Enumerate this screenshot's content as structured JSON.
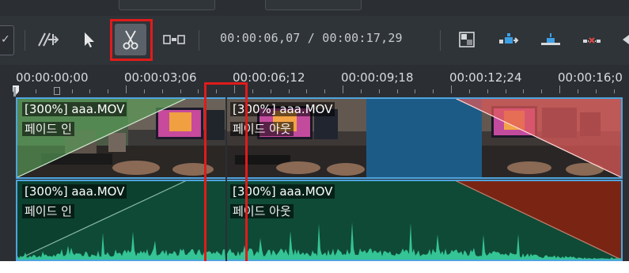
{
  "toolbar": {
    "tools": [
      {
        "name": "spacer-tool",
        "icon": "spacer-icon",
        "active": false
      },
      {
        "name": "select-tool",
        "icon": "cursor-icon",
        "active": false
      },
      {
        "name": "razor-tool",
        "icon": "scissors-icon",
        "active": true
      },
      {
        "name": "slip-tool",
        "icon": "slip-icon",
        "active": false
      }
    ],
    "position": "00:00:06,07",
    "separator": "/",
    "duration": "00:00:17,29",
    "right_tools": [
      "split-view-icon",
      "insert-icon",
      "overwrite-icon",
      "extract-icon",
      "lift-icon"
    ]
  },
  "ruler": {
    "labels": [
      "00:00:00;00",
      "00:00:03;06",
      "00:00:06;12",
      "00:00:09;18",
      "00:00:12;24",
      "00:00:16;0"
    ]
  },
  "tracks": {
    "video": [
      {
        "title": "[300%] aaa.MOV",
        "effect": "페이드 인"
      },
      {
        "title": "[300%] aaa.MOV",
        "effect": "페이드 아웃"
      }
    ],
    "audio": [
      {
        "title": "[300%] aaa.MOV",
        "effect": "페이드 인"
      },
      {
        "title": "[300%] aaa.MOV",
        "effect": "페이드 아웃"
      }
    ]
  },
  "colors": {
    "highlight": "#e01b1b",
    "clip_border": "#4ea4de",
    "fade_in_video": "#5aa45a",
    "fade_out_video": "#e05a5a",
    "audio_bg": "#0f4a36",
    "audio_wave": "#34c495",
    "fade_out_audio": "#7a2514"
  }
}
